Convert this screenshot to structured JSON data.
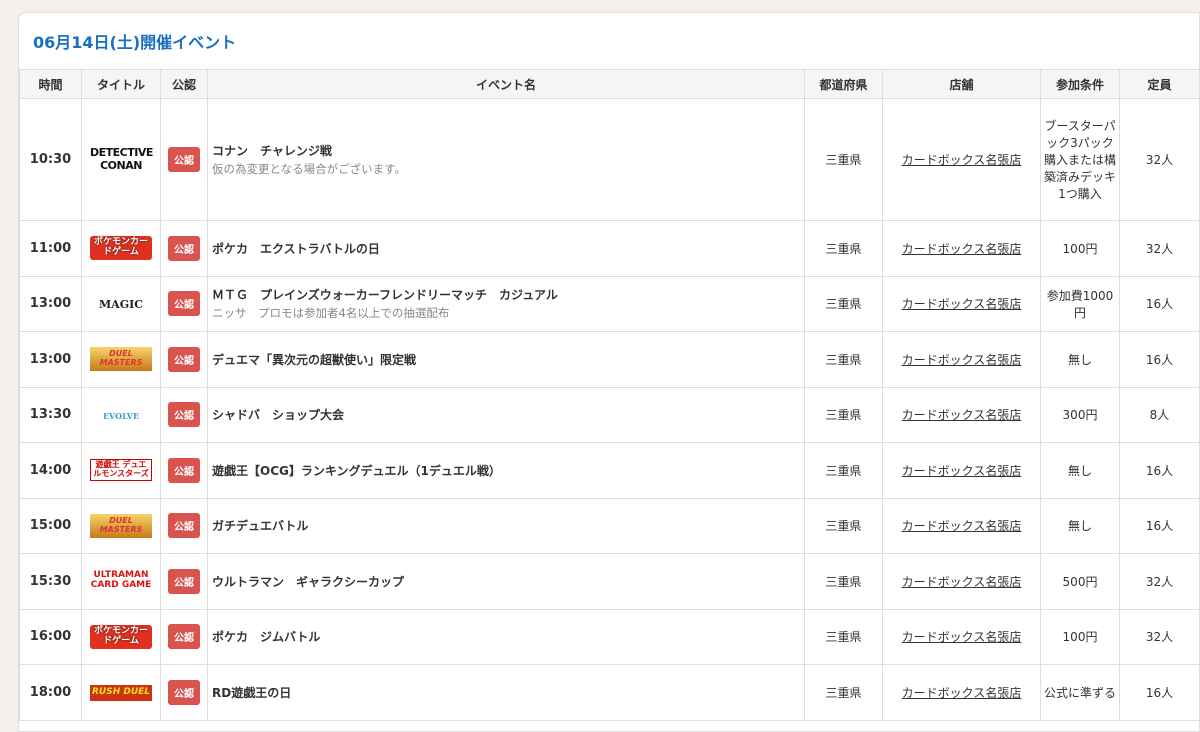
{
  "page_title": "06月14日(土)開催イベント",
  "headers": [
    "時間",
    "タイトル",
    "公認",
    "イベント名",
    "都道府県",
    "店舗",
    "参加条件",
    "定員"
  ],
  "badge_label": "公認",
  "rows": [
    {
      "time": "10:30",
      "logo": "DETECTIVE CONAN",
      "logo_class": "l-conan",
      "name": "コナン　チャレンジ戦",
      "sub": "仮の為変更となる場合がございます。",
      "pref": "三重県",
      "shop": "カードボックス名張店",
      "cond": "ブースターパック3パック購入または構築済みデッキ1つ購入",
      "cap": "32人"
    },
    {
      "time": "11:00",
      "logo": "ポケモンカードゲーム",
      "logo_class": "l-poke",
      "name": "ポケカ　エクストラバトルの日",
      "sub": "",
      "pref": "三重県",
      "shop": "カードボックス名張店",
      "cond": "100円",
      "cap": "32人"
    },
    {
      "time": "13:00",
      "logo": "MAGIC",
      "logo_class": "l-magic",
      "name": "ＭＴＧ　プレインズウォーカーフレンドリーマッチ　カジュアル",
      "sub": "ニッサ　プロモは参加者4名以上での抽選配布",
      "pref": "三重県",
      "shop": "カードボックス名張店",
      "cond": "参加費1000円",
      "cap": "16人"
    },
    {
      "time": "13:00",
      "logo": "DUEL MASTERS",
      "logo_class": "l-dm",
      "name": "デュエマ「異次元の超獣使い」限定戦",
      "sub": "",
      "pref": "三重県",
      "shop": "カードボックス名張店",
      "cond": "無し",
      "cap": "16人"
    },
    {
      "time": "13:30",
      "logo": "EVOLVE",
      "logo_class": "l-sv",
      "name": "シャドバ　ショップ大会",
      "sub": "",
      "pref": "三重県",
      "shop": "カードボックス名張店",
      "cond": "300円",
      "cap": "8人"
    },
    {
      "time": "14:00",
      "logo": "遊戯王 デュエルモンスターズ",
      "logo_class": "l-ygo",
      "name": "遊戯王【OCG】ランキングデュエル（1デュエル戦）",
      "sub": "",
      "pref": "三重県",
      "shop": "カードボックス名張店",
      "cond": "無し",
      "cap": "16人"
    },
    {
      "time": "15:00",
      "logo": "DUEL MASTERS",
      "logo_class": "l-dm",
      "name": "ガチデュエバトル",
      "sub": "",
      "pref": "三重県",
      "shop": "カードボックス名張店",
      "cond": "無し",
      "cap": "16人"
    },
    {
      "time": "15:30",
      "logo": "ULTRAMAN CARD GAME",
      "logo_class": "l-ultra",
      "name": "ウルトラマン　ギャラクシーカップ",
      "sub": "",
      "pref": "三重県",
      "shop": "カードボックス名張店",
      "cond": "500円",
      "cap": "32人"
    },
    {
      "time": "16:00",
      "logo": "ポケモンカードゲーム",
      "logo_class": "l-poke",
      "name": "ポケカ　ジムバトル",
      "sub": "",
      "pref": "三重県",
      "shop": "カードボックス名張店",
      "cond": "100円",
      "cap": "32人"
    },
    {
      "time": "18:00",
      "logo": "RUSH DUEL",
      "logo_class": "l-rush",
      "name": "RD遊戯王の日",
      "sub": "",
      "pref": "三重県",
      "shop": "カードボックス名張店",
      "cond": "公式に準ずる",
      "cap": "16人"
    }
  ]
}
